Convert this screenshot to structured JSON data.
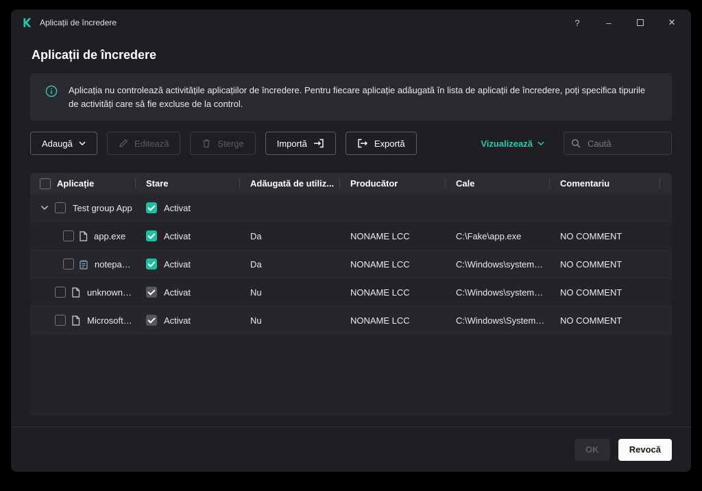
{
  "window": {
    "app_title": "Aplicații de încredere",
    "controls": {
      "help": "?",
      "minimize": "–",
      "close": "✕"
    }
  },
  "page": {
    "title": "Aplicații de încredere",
    "info_text": "Aplicația nu controlează activitățile aplicațiilor de încredere. Pentru fiecare aplicație adăugată în lista de aplicații de încredere, poți specifica tipurile de activități care să fie excluse de la control."
  },
  "toolbar": {
    "add_label": "Adaugă",
    "edit_label": "Editează",
    "delete_label": "Șterge",
    "import_label": "Importă",
    "export_label": "Exportă",
    "view_label": "Vizualizează",
    "search_placeholder": "Caută"
  },
  "table": {
    "columns": {
      "application": "Aplicație",
      "state": "Stare",
      "added_by_user": "Adăugată de utiliz...",
      "producer": "Producător",
      "path": "Cale",
      "comment": "Comentariu"
    },
    "select_all_state": "unchecked",
    "rows": [
      {
        "level": "group",
        "expanded": true,
        "name": "Test group App",
        "select_state": "unchecked",
        "state": "checked-green",
        "state_label": "Activat",
        "added": "",
        "producer": "",
        "path": "",
        "comment": ""
      },
      {
        "level": "child",
        "icon": "file-icon",
        "name": "app.exe",
        "select_state": "unchecked",
        "state": "checked-green",
        "state_label": "Activat",
        "added": "Da",
        "producer": "NONAME LCC",
        "path": "C:\\Fake\\app.exe",
        "comment": "NO COMMENT"
      },
      {
        "level": "child",
        "icon": "notepad-icon",
        "name": "notepa…",
        "select_state": "unchecked",
        "state": "checked-green",
        "state_label": "Activat",
        "added": "Da",
        "producer": "NONAME LCC",
        "path": "C:\\Windows\\system…",
        "comment": "NO COMMENT"
      },
      {
        "level": "root",
        "icon": "file-icon",
        "name": "unknown…",
        "select_state": "unchecked",
        "state": "checked-gray",
        "state_label": "Activat",
        "added": "Nu",
        "producer": "NONAME LCC",
        "path": "C:\\Windows\\system…",
        "comment": "NO COMMENT"
      },
      {
        "level": "root",
        "icon": "file-icon",
        "name": "Microsoft…",
        "select_state": "unchecked",
        "state": "checked-gray",
        "state_label": "Activat",
        "added": "Nu",
        "producer": "NONAME LCC",
        "path": "C:\\Windows\\System…",
        "comment": "NO COMMENT"
      }
    ]
  },
  "footer": {
    "ok_label": "OK",
    "cancel_label": "Revocă"
  },
  "colors": {
    "accent": "#29ccb1",
    "checkbox_checked": "#1fbd9f",
    "checkbox_disabled": "#56565d",
    "window_bg": "#1e1e23",
    "table_bg": "#232329"
  }
}
